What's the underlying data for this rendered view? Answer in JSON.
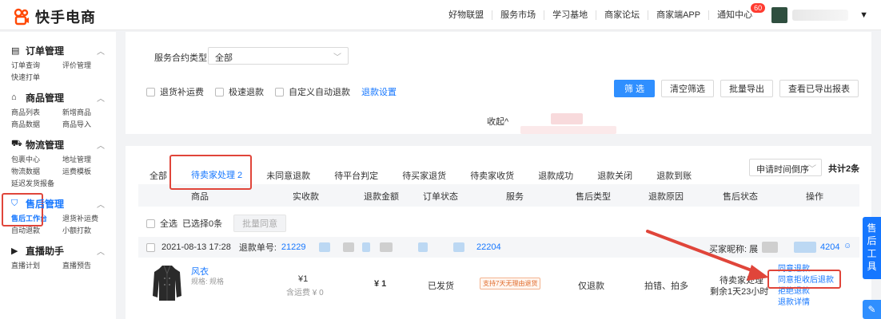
{
  "header": {
    "brand": "快手电商",
    "nav": [
      "好物联盟",
      "服务市场",
      "学习基地",
      "商家论坛",
      "商家端APP"
    ],
    "notify_label": "通知中心",
    "notify_count": "60"
  },
  "sidebar": {
    "sections": [
      {
        "title": "订单管理",
        "icon": "order-icon",
        "items": [
          "订单查询",
          "评价管理",
          "快速打单"
        ]
      },
      {
        "title": "商品管理",
        "icon": "goods-icon",
        "items": [
          "商品列表",
          "新增商品",
          "商品数据",
          "商品导入"
        ]
      },
      {
        "title": "物流管理",
        "icon": "truck-icon",
        "items": [
          "包裹中心",
          "地址管理",
          "物流数据",
          "运费模板",
          "延迟发货报备"
        ]
      },
      {
        "title": "售后管理",
        "icon": "shield-icon",
        "items": [
          "售后工作台",
          "退货补运费",
          "自动退款",
          "小额打款"
        ]
      },
      {
        "title": "直播助手",
        "icon": "live-icon",
        "items": [
          "直播计划",
          "直播预告"
        ]
      }
    ]
  },
  "filter": {
    "service_label": "服务合约类型:",
    "service_value": "全部",
    "checks": [
      "退货补运费",
      "极速退款",
      "自定义自动退款"
    ],
    "refund_setting_link": "退款设置",
    "buttons": {
      "filter": "筛 选",
      "clear": "清空筛选",
      "export": "批量导出",
      "view_export": "查看已导出报表"
    },
    "collapse": "收起^"
  },
  "list": {
    "tabs": [
      "全部",
      "待卖家处理 2",
      "未同意退款",
      "待平台判定",
      "待买家退货",
      "待卖家收货",
      "退款成功",
      "退款关闭",
      "退款到账"
    ],
    "active_tab": "待卖家处理 2",
    "sort_value": "申请时间倒序",
    "total": "共计2条",
    "columns": [
      "商品",
      "实收款",
      "退款金额",
      "订单状态",
      "服务",
      "售后类型",
      "退款原因",
      "售后状态",
      "操作"
    ],
    "select_all": "全选",
    "selected_count": "已选择0条",
    "batch_agree": "批量同意",
    "order": {
      "date": "2021-08-13 17:28",
      "refund_no_label": "退款单号:",
      "refund_no_start": "21229",
      "refund_no_end": "22204",
      "buyer_label": "买家昵称:",
      "buyer_prefix": "展",
      "buyer_suffix": "4204",
      "product_name": "风衣",
      "product_spec": "规格: 规格",
      "paid": "¥1",
      "paid_sub": "含运费 ¥ 0",
      "refund_amount": "¥ 1",
      "order_status": "已发货",
      "service_tag": "支持7天无理由退货",
      "aftersale_type": "仅退款",
      "refund_reason": "拍错、拍多",
      "aftersale_status": "待卖家处理",
      "remaining": "剩余1天23小时",
      "ops": [
        "同意退款",
        "同意拒收后退款",
        "拒绝退款",
        "退款详情"
      ]
    }
  },
  "floating_tool": "售后工具",
  "colors": {
    "accent": "#1677ff",
    "highlight_red": "#e0453a",
    "brand_red": "#ff4906"
  }
}
